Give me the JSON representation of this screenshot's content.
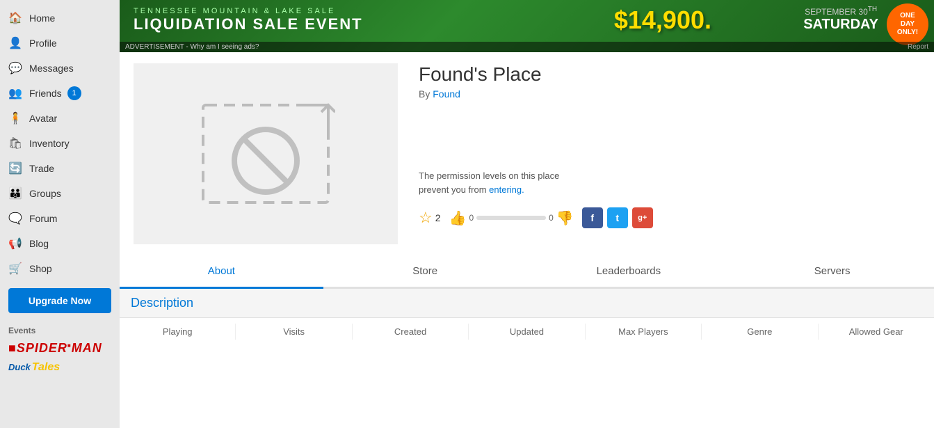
{
  "sidebar": {
    "items": [
      {
        "id": "home",
        "label": "Home",
        "icon": "🏠"
      },
      {
        "id": "profile",
        "label": "Profile",
        "icon": "👤"
      },
      {
        "id": "messages",
        "label": "Messages",
        "icon": "💬"
      },
      {
        "id": "friends",
        "label": "Friends",
        "icon": "👥",
        "badge": "1"
      },
      {
        "id": "avatar",
        "label": "Avatar",
        "icon": "🧍"
      },
      {
        "id": "inventory",
        "label": "Inventory",
        "icon": "🛍"
      },
      {
        "id": "trade",
        "label": "Trade",
        "icon": "🔄"
      },
      {
        "id": "groups",
        "label": "Groups",
        "icon": "👪"
      },
      {
        "id": "forum",
        "label": "Forum",
        "icon": "💬"
      },
      {
        "id": "blog",
        "label": "Blog",
        "icon": "📢"
      },
      {
        "id": "shop",
        "label": "Shop",
        "icon": "🛒"
      }
    ],
    "upgrade_label": "Upgrade Now",
    "events_label": "Events"
  },
  "ad": {
    "price": "$14,900.",
    "line1": "TENNESSEE MOUNTAIN & LAKE SALE",
    "line2": "LIQUIDATION SALE EVENT",
    "line3": "September 30th Saturday",
    "oneday_line1": "ONE",
    "oneday_line2": "DAY",
    "oneday_line3": "ONLY!",
    "footer_left": "ADVERTISEMENT - Why am I seeing ads?",
    "footer_right": "Report"
  },
  "place": {
    "title": "Found's Place",
    "by_label": "By",
    "author": "Found",
    "permission_text": "The permission levels on this place\nprevent you from entering.",
    "star_count": "2",
    "vote_up_count": "0",
    "vote_down_count": "0"
  },
  "tabs": [
    {
      "id": "about",
      "label": "About",
      "active": true
    },
    {
      "id": "store",
      "label": "Store"
    },
    {
      "id": "leaderboards",
      "label": "Leaderboards"
    },
    {
      "id": "servers",
      "label": "Servers"
    }
  ],
  "description": {
    "heading": "Description"
  },
  "stats": {
    "columns": [
      "Playing",
      "Visits",
      "Created",
      "Updated",
      "Max Players",
      "Genre",
      "Allowed Gear"
    ]
  },
  "social": {
    "facebook": "f",
    "twitter": "t",
    "googleplus": "g+"
  }
}
